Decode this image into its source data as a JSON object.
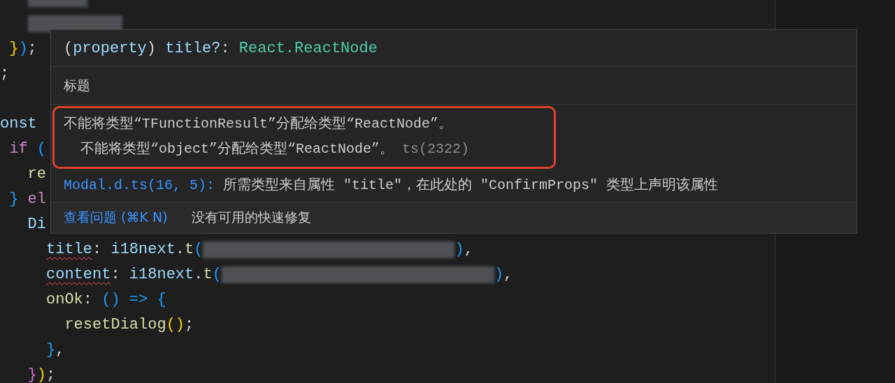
{
  "editor": {
    "lines": [
      {
        "tokens": [
          {
            "kind": "redacted"
          }
        ]
      },
      {
        "tokens": [
          {
            "kind": "redacted"
          }
        ]
      },
      {
        "tokens": [
          {
            "text": " }",
            "kind": "brace1"
          },
          {
            "text": ")",
            "kind": "brace3"
          },
          {
            "text": ";",
            "kind": "plain"
          }
        ]
      },
      {
        "tokens": [
          {
            "text": ";",
            "kind": "plain"
          }
        ]
      },
      {
        "kind": "blank"
      },
      {
        "tokens": [
          {
            "text": "onst",
            "kind": "var"
          }
        ]
      },
      {
        "tokens": [
          {
            "text": " if",
            "kind": "keyword"
          },
          {
            "text": " (",
            "kind": "brace3"
          }
        ]
      },
      {
        "tokens": [
          {
            "text": "   re",
            "kind": "func"
          }
        ]
      },
      {
        "tokens": [
          {
            "text": " }",
            "kind": "brace3"
          },
          {
            "text": " el",
            "kind": "keyword"
          }
        ]
      },
      {
        "tokens": [
          {
            "text": "   Di",
            "kind": "var"
          }
        ]
      },
      {
        "tokens": [
          {
            "text": "     title",
            "kind": "var",
            "squiggle": true
          },
          {
            "text": ": ",
            "kind": "plain"
          },
          {
            "text": "i18next",
            "kind": "var"
          },
          {
            "text": ".",
            "kind": "plain"
          },
          {
            "text": "t",
            "kind": "func"
          },
          {
            "text": "(",
            "kind": "brace3"
          },
          {
            "kind": "redacted"
          },
          {
            "text": ")",
            "kind": "brace3"
          },
          {
            "text": ",",
            "kind": "plain"
          }
        ]
      },
      {
        "tokens": [
          {
            "text": "     content",
            "kind": "var",
            "squiggle": true
          },
          {
            "text": ": ",
            "kind": "plain"
          },
          {
            "text": "i18next",
            "kind": "var"
          },
          {
            "text": ".",
            "kind": "plain"
          },
          {
            "text": "t",
            "kind": "func"
          },
          {
            "text": "(",
            "kind": "brace3"
          },
          {
            "kind": "redacted"
          },
          {
            "text": ")",
            "kind": "brace3"
          },
          {
            "text": ",",
            "kind": "plain"
          }
        ]
      },
      {
        "tokens": [
          {
            "text": "     onOk",
            "kind": "func"
          },
          {
            "text": ": ",
            "kind": "plain"
          },
          {
            "text": "() => {",
            "kind": "brace3"
          }
        ]
      },
      {
        "tokens": [
          {
            "text": "       resetDialog",
            "kind": "func"
          },
          {
            "text": "()",
            "kind": "brace1"
          },
          {
            "text": ";",
            "kind": "plain"
          }
        ]
      },
      {
        "tokens": [
          {
            "text": "     }",
            "kind": "brace3"
          },
          {
            "text": ",",
            "kind": "plain"
          }
        ]
      },
      {
        "tokens": [
          {
            "text": "   }",
            "kind": "brace2"
          },
          {
            "text": ")",
            "kind": "brace1"
          },
          {
            "text": ";",
            "kind": "plain"
          }
        ]
      }
    ]
  },
  "hover": {
    "signature": [
      {
        "text": "(",
        "kind": "plain"
      },
      {
        "text": "property",
        "kind": "var"
      },
      {
        "text": ") ",
        "kind": "plain"
      },
      {
        "text": "title?",
        "kind": "var"
      },
      {
        "text": ": ",
        "kind": "plain"
      },
      {
        "text": "React.ReactNode",
        "kind": "type"
      }
    ],
    "doc": "标题",
    "errors": [
      "不能将类型“TFunctionResult”分配给类型“ReactNode”。",
      "  不能将类型“object”分配给类型“ReactNode”。"
    ],
    "error_code": "ts(2322)",
    "related": {
      "link": "Modal.d.ts(16, 5):",
      "text": "所需类型来自属性 \"title\"，在此处的 \"ConfirmProps\" 类型上声明该属性"
    },
    "actions": [
      {
        "kind": "link",
        "label": "查看问题 (⌘K N)"
      },
      {
        "kind": "text",
        "label": "没有可用的快速修复"
      }
    ]
  }
}
